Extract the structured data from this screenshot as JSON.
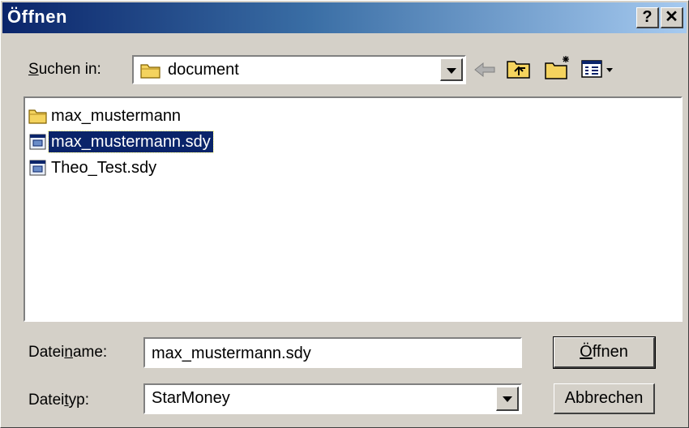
{
  "window": {
    "title": "Öffnen",
    "help_label": "?",
    "close_label": "✕"
  },
  "lookin": {
    "label": "Suchen in:",
    "value": "document"
  },
  "toolbar": {
    "back_icon": "back-arrow-icon",
    "up_icon": "up-folder-icon",
    "new_folder_icon": "new-folder-icon",
    "view_icon": "view-menu-icon"
  },
  "files": [
    {
      "name": "max_mustermann",
      "type": "folder",
      "selected": false
    },
    {
      "name": "max_mustermann.sdy",
      "type": "sdy-file",
      "selected": true
    },
    {
      "name": "Theo_Test.sdy",
      "type": "sdy-file",
      "selected": false
    }
  ],
  "filename": {
    "label": "Dateiname:",
    "value": "max_mustermann.sdy"
  },
  "filetype": {
    "label": "Dateityp:",
    "value": "StarMoney"
  },
  "buttons": {
    "open": "Öffnen",
    "cancel": "Abbrechen"
  },
  "colors": {
    "selection": "#0a246a",
    "title_start": "#0a246a",
    "title_end": "#a6caf0",
    "face": "#d4d0c8"
  }
}
